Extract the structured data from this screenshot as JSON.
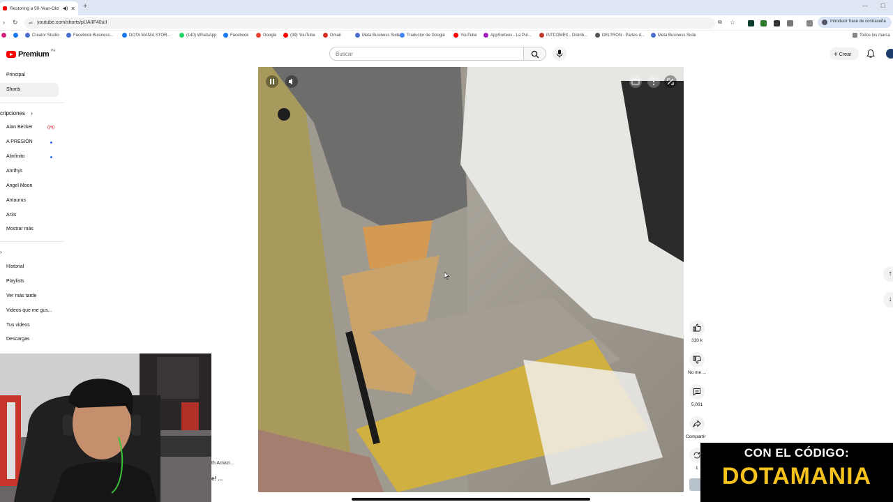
{
  "browser": {
    "tab_title": "Restoring a 50-Year-Old Pa",
    "url": "youtube.com/shorts/pUAIIF40uII",
    "password_prompt": "Introducir frase de contraseña",
    "all_bookmarks": "Todos los marca",
    "bookmarks": [
      {
        "label": "Creator Studio",
        "color": "#4a6fd1"
      },
      {
        "label": "Facebook Business...",
        "color": "#4a6fd1"
      },
      {
        "label": "DOTA MANIA STOR...",
        "color": "#1877f2"
      },
      {
        "label": "(140) WhatsApp",
        "color": "#25d366"
      },
      {
        "label": "Facebook",
        "color": "#1877f2"
      },
      {
        "label": "Google",
        "color": "#ea4335"
      },
      {
        "label": "(39) YouTube",
        "color": "#ff0000"
      },
      {
        "label": "Gmail",
        "color": "#d93025"
      },
      {
        "label": "Meta Business Suite",
        "color": "#4a6fd1"
      },
      {
        "label": "Traductor de Google",
        "color": "#4285f4"
      },
      {
        "label": "YouTube",
        "color": "#ff0000"
      },
      {
        "label": "AppSorteos - La Pul...",
        "color": "#a020c0"
      },
      {
        "label": "INTCOMEX - Distrib...",
        "color": "#c0392b"
      },
      {
        "label": "DELTRON - Partes d...",
        "color": "#555555"
      },
      {
        "label": "Meta Business Suite",
        "color": "#4a6fd1"
      }
    ]
  },
  "header": {
    "logo_text": "Premium",
    "logo_sup": "PE",
    "search_placeholder": "Buscar",
    "create_label": "Crear"
  },
  "sidebar": {
    "main": [
      "Principal",
      "Shorts"
    ],
    "subs_heading": "cripciones",
    "subs": [
      {
        "name": "Alan Becker",
        "badge": "live"
      },
      {
        "name": "A PRESIÓN",
        "badge": "dot"
      },
      {
        "name": "Alinfinito",
        "badge": "dot"
      },
      {
        "name": "Amthys",
        "badge": ""
      },
      {
        "name": "Angel Moon",
        "badge": ""
      },
      {
        "name": "Antaurus",
        "badge": ""
      },
      {
        "name": "Ar3s",
        "badge": ""
      }
    ],
    "show_more": "Mostrar más",
    "you_heading": "",
    "you": [
      "Historial",
      "Playlists",
      "Ver más tarde",
      "Videos que me gus...",
      "Tus videos",
      "Descargas"
    ]
  },
  "actions": {
    "likes": "310 k",
    "dislike": "No me ...",
    "comments": "5,001",
    "share": "Compartir",
    "remix": "1"
  },
  "behind_text": {
    "line1": "th Amazi...",
    "line2": "e! ..."
  },
  "promo": {
    "line1": "CON EL CÓDIGO:",
    "line2": "DOTAMANIA"
  }
}
